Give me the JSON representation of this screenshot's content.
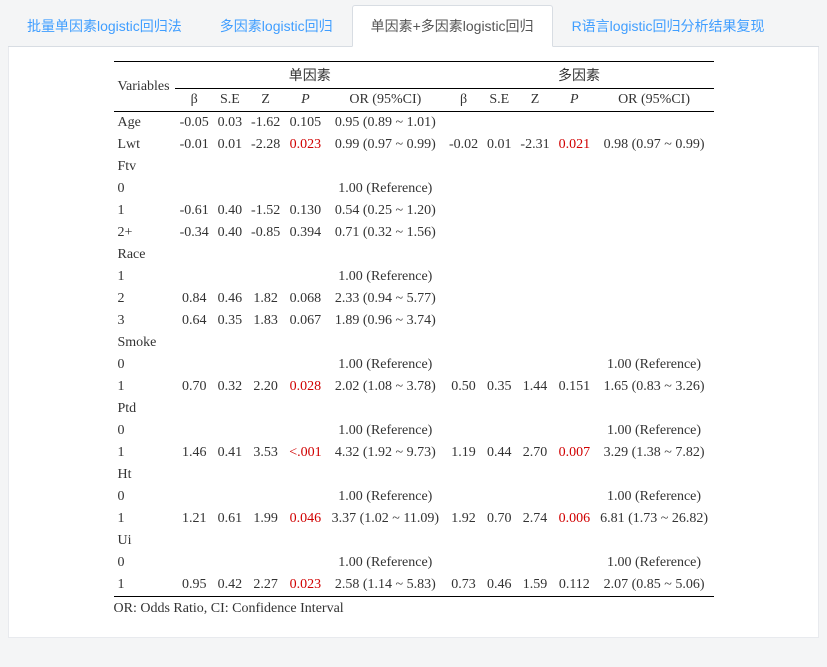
{
  "tabs": [
    {
      "label": "批量单因素logistic回归法"
    },
    {
      "label": "多因素logistic回归"
    },
    {
      "label": "单因素+多因素logistic回归"
    },
    {
      "label": "R语言logistic回归分析结果复现"
    }
  ],
  "headers": {
    "variables": "Variables",
    "uni_group": "单因素",
    "multi_group": "多因素",
    "beta": "β",
    "se": "S.E",
    "z": "Z",
    "p": "P",
    "or": "OR (95%CI)"
  },
  "rows": [
    {
      "label": "Age",
      "lvl": 0,
      "uni": {
        "b": "-0.05",
        "se": "0.03",
        "z": "-1.62",
        "p": "0.105",
        "sig": false,
        "or": "0.95 (0.89 ~ 1.01)"
      }
    },
    {
      "label": "Lwt",
      "lvl": 0,
      "uni": {
        "b": "-0.01",
        "se": "0.01",
        "z": "-2.28",
        "p": "0.023",
        "sig": true,
        "or": "0.99 (0.97 ~ 0.99)"
      },
      "multi": {
        "b": "-0.02",
        "se": "0.01",
        "z": "-2.31",
        "p": "0.021",
        "sig": true,
        "or": "0.98 (0.97 ~ 0.99)"
      }
    },
    {
      "label": "Ftv",
      "lvl": 0
    },
    {
      "label": "0",
      "lvl": 1,
      "uni": {
        "or": "1.00 (Reference)"
      }
    },
    {
      "label": "1",
      "lvl": 1,
      "uni": {
        "b": "-0.61",
        "se": "0.40",
        "z": "-1.52",
        "p": "0.130",
        "sig": false,
        "or": "0.54 (0.25 ~ 1.20)"
      }
    },
    {
      "label": "2+",
      "lvl": 1,
      "uni": {
        "b": "-0.34",
        "se": "0.40",
        "z": "-0.85",
        "p": "0.394",
        "sig": false,
        "or": "0.71 (0.32 ~ 1.56)"
      }
    },
    {
      "label": "Race",
      "lvl": 0
    },
    {
      "label": "1",
      "lvl": 1,
      "uni": {
        "or": "1.00 (Reference)"
      }
    },
    {
      "label": "2",
      "lvl": 1,
      "uni": {
        "b": "0.84",
        "se": "0.46",
        "z": "1.82",
        "p": "0.068",
        "sig": false,
        "or": "2.33 (0.94 ~ 5.77)"
      }
    },
    {
      "label": "3",
      "lvl": 1,
      "uni": {
        "b": "0.64",
        "se": "0.35",
        "z": "1.83",
        "p": "0.067",
        "sig": false,
        "or": "1.89 (0.96 ~ 3.74)"
      }
    },
    {
      "label": "Smoke",
      "lvl": 0
    },
    {
      "label": "0",
      "lvl": 1,
      "uni": {
        "or": "1.00 (Reference)"
      },
      "multi": {
        "or": "1.00 (Reference)"
      }
    },
    {
      "label": "1",
      "lvl": 1,
      "uni": {
        "b": "0.70",
        "se": "0.32",
        "z": "2.20",
        "p": "0.028",
        "sig": true,
        "or": "2.02 (1.08 ~ 3.78)"
      },
      "multi": {
        "b": "0.50",
        "se": "0.35",
        "z": "1.44",
        "p": "0.151",
        "sig": false,
        "or": "1.65 (0.83 ~ 3.26)"
      }
    },
    {
      "label": "Ptd",
      "lvl": 0
    },
    {
      "label": "0",
      "lvl": 1,
      "uni": {
        "or": "1.00 (Reference)"
      },
      "multi": {
        "or": "1.00 (Reference)"
      }
    },
    {
      "label": "1",
      "lvl": 1,
      "uni": {
        "b": "1.46",
        "se": "0.41",
        "z": "3.53",
        "p": "<.001",
        "sig": true,
        "or": "4.32 (1.92 ~ 9.73)"
      },
      "multi": {
        "b": "1.19",
        "se": "0.44",
        "z": "2.70",
        "p": "0.007",
        "sig": true,
        "or": "3.29 (1.38 ~ 7.82)"
      }
    },
    {
      "label": "Ht",
      "lvl": 0
    },
    {
      "label": "0",
      "lvl": 1,
      "uni": {
        "or": "1.00 (Reference)"
      },
      "multi": {
        "or": "1.00 (Reference)"
      }
    },
    {
      "label": "1",
      "lvl": 1,
      "uni": {
        "b": "1.21",
        "se": "0.61",
        "z": "1.99",
        "p": "0.046",
        "sig": true,
        "or": "3.37 (1.02 ~ 11.09)"
      },
      "multi": {
        "b": "1.92",
        "se": "0.70",
        "z": "2.74",
        "p": "0.006",
        "sig": true,
        "or": "6.81 (1.73 ~ 26.82)"
      }
    },
    {
      "label": "Ui",
      "lvl": 0
    },
    {
      "label": "0",
      "lvl": 1,
      "uni": {
        "or": "1.00 (Reference)"
      },
      "multi": {
        "or": "1.00 (Reference)"
      }
    },
    {
      "label": "1",
      "lvl": 1,
      "uni": {
        "b": "0.95",
        "se": "0.42",
        "z": "2.27",
        "p": "0.023",
        "sig": true,
        "or": "2.58 (1.14 ~ 5.83)"
      },
      "multi": {
        "b": "0.73",
        "se": "0.46",
        "z": "1.59",
        "p": "0.112",
        "sig": false,
        "or": "2.07 (0.85 ~ 5.06)"
      }
    }
  ],
  "footnote": "OR: Odds Ratio, CI: Confidence Interval"
}
